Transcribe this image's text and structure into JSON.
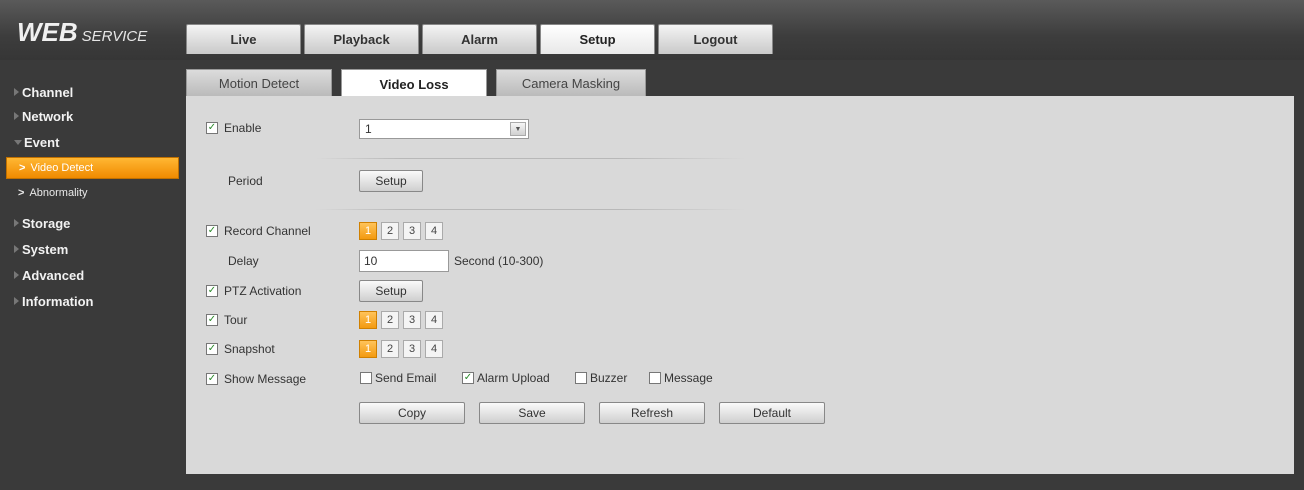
{
  "header": {
    "logo_main": "WEB",
    "logo_sub": "SERVICE",
    "nav": [
      "Live",
      "Playback",
      "Alarm",
      "Setup",
      "Logout"
    ],
    "active_nav": "Setup"
  },
  "sidebar": {
    "items": [
      {
        "label": "Channel"
      },
      {
        "label": "Network"
      },
      {
        "label": "Event",
        "expanded": true
      },
      {
        "label": "Storage"
      },
      {
        "label": "System"
      },
      {
        "label": "Advanced"
      },
      {
        "label": "Information"
      }
    ],
    "sub_items": [
      {
        "label": "Video Detect",
        "active": true
      },
      {
        "label": "Abnormality"
      }
    ],
    "sub_arrow": ">"
  },
  "subtabs": [
    "Motion Detect",
    "Video Loss",
    "Camera Masking"
  ],
  "active_subtab": "Video Loss",
  "form": {
    "enable_label": "Enable",
    "enable_checked": true,
    "channel_value": "1",
    "dropdown_icon": "▼",
    "period_label": "Period",
    "setup_label": "Setup",
    "record_channel_label": "Record Channel",
    "record_channel_checked": true,
    "channels": [
      "1",
      "2",
      "3",
      "4"
    ],
    "delay_label": "Delay",
    "delay_value": "10",
    "delay_hint": "Second (10-300)",
    "ptz_label": "PTZ Activation",
    "ptz_checked": true,
    "tour_label": "Tour",
    "tour_checked": true,
    "snapshot_label": "Snapshot",
    "snapshot_checked": true,
    "show_message_label": "Show Message",
    "show_message_checked": true,
    "options": [
      {
        "label": "Send Email",
        "checked": false
      },
      {
        "label": "Alarm Upload",
        "checked": true
      },
      {
        "label": "Buzzer",
        "checked": false
      },
      {
        "label": "Message",
        "checked": false
      }
    ],
    "check_mark": "✓"
  },
  "buttons": {
    "copy": "Copy",
    "save": "Save",
    "refresh": "Refresh",
    "default": "Default"
  },
  "colors": {
    "accent": "#f39a10",
    "background": "#3a3a3a",
    "panel": "#d9d9d9"
  }
}
